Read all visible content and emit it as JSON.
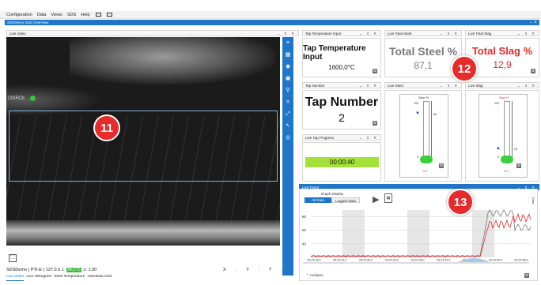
{
  "menu": [
    "Configuration",
    "Data",
    "Views",
    "SDS",
    "Help"
  ],
  "window_title": "SDSDemo SDS OverView",
  "live_video": {
    "title": "Live Video",
    "roi_label": "OSROI",
    "callout": "11"
  },
  "status": {
    "source": "SDSDemo ( PTI-E ) 127.0.0.1",
    "temp": "34,1°C",
    "zoom": "z: 1.00",
    "x": "X:",
    "y": "Y:",
    "t": "T:"
  },
  "bottom_tabs": [
    "Live Video",
    "Live Histogram",
    "Steel Temperature",
    "UserData Grid"
  ],
  "tap_temp": {
    "header": "Tap Temperature Input",
    "title": "Tap Temperature Input",
    "value": "1600,0°C"
  },
  "tap_number": {
    "header": "Tap Number",
    "title": "Tap Number",
    "value": "2"
  },
  "tap_progress": {
    "header": "Live Tap Progress",
    "value": "00:00:40"
  },
  "total_steel": {
    "header": "Live Total Steel",
    "title": "Total Steel %",
    "value": "87,1"
  },
  "total_slag": {
    "header": "Live Total Slag",
    "title": "Total Slag %",
    "value": "12,9"
  },
  "live_steel": {
    "header": "Live Steel",
    "label": "Steel %",
    "top": "100",
    "mark": "80",
    "bottom": "0",
    "reading": "0,0"
  },
  "live_slag": {
    "header": "Live Slag",
    "label": "Slag %",
    "top": "100",
    "mark": "20",
    "bottom": "0",
    "reading": "0,0"
  },
  "callout_12": "12",
  "callout_13": "13",
  "trend": {
    "header": "Live Trend",
    "graph_display": "Graph Display",
    "all_data": "All Data",
    "logged_data": "Logged Data",
    "y_ticks": [
      "80",
      "60",
      "40"
    ],
    "x_ticks": [
      "09:24:18,0",
      "09:24:23,0",
      "09:24:28,0",
      "09:24:33,0",
      "09:24:38,0",
      "09:24:43,0",
      "09:24:48,0",
      "09:24:53,0",
      "09:24:58,0"
    ],
    "analysis": "Analysis",
    "side_label": "Data"
  },
  "colors": {
    "accent": "#1f76c8",
    "steel": "#7a7a7a",
    "slag": "#e52b2b",
    "progress": "#a4e23a",
    "callout": "#e52b2b"
  }
}
